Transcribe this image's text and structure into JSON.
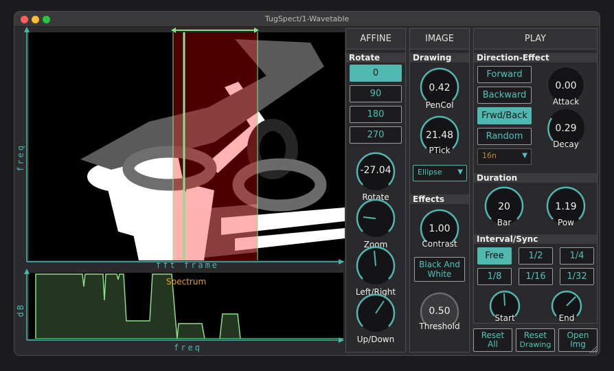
{
  "window": {
    "title": "TugSpect/1-Wavetable"
  },
  "plot": {
    "main_y_label": "freq",
    "main_x_label": "fft frame",
    "spectrum_title": "Spectrum",
    "spectrum_y_label": "dB",
    "spectrum_x_label": "freq"
  },
  "affine": {
    "header": "AFFINE",
    "rotate_section": "Rotate",
    "rotate_buttons": [
      "0",
      "90",
      "180",
      "270"
    ],
    "rotate_knob": {
      "value": "-27.04",
      "label": "Rotate"
    },
    "zoom_label": "Zoom",
    "leftright_label": "Left/Right",
    "updown_label": "Up/Down"
  },
  "image": {
    "header": "IMAGE",
    "drawing_section": "Drawing",
    "pencol": {
      "value": "0.42",
      "label": "PenCol"
    },
    "ptick": {
      "value": "21.48",
      "label": "PTick"
    },
    "shape_select": "Ellipse",
    "effects_section": "Effects",
    "contrast": {
      "value": "1.00",
      "label": "Contrast"
    },
    "bw_button": [
      "Black And",
      "White"
    ],
    "threshold": {
      "value": "0.50",
      "label": "Threshold"
    }
  },
  "play": {
    "header": "PLAY",
    "direction_section": "Direction-Effect",
    "direction_buttons": [
      "Forward",
      "Backward",
      "Frwd/Back",
      "Random"
    ],
    "rate_select": "16n",
    "attack": {
      "value": "0.00",
      "label": "Attack"
    },
    "decay": {
      "value": "0.29",
      "label": "Decay"
    },
    "duration_section": "Duration",
    "bar": {
      "value": "20",
      "label": "Bar"
    },
    "pow": {
      "value": "1.19",
      "label": "Pow"
    },
    "interval_section": "Interval/Sync",
    "interval_buttons": [
      "Free",
      "1/2",
      "1/4",
      "1/8",
      "1/16",
      "1/32"
    ],
    "start_label": "Start",
    "end_label": "End"
  },
  "footer": {
    "reset_all": [
      "Reset",
      "All"
    ],
    "reset_drawing": [
      "Reset",
      "Drawing"
    ],
    "open_img": [
      "Open",
      "Img"
    ]
  },
  "colors": {
    "accent": "#4fb8b0",
    "playhead": "#8fe08a",
    "spectrum_label": "#e8a21c"
  }
}
